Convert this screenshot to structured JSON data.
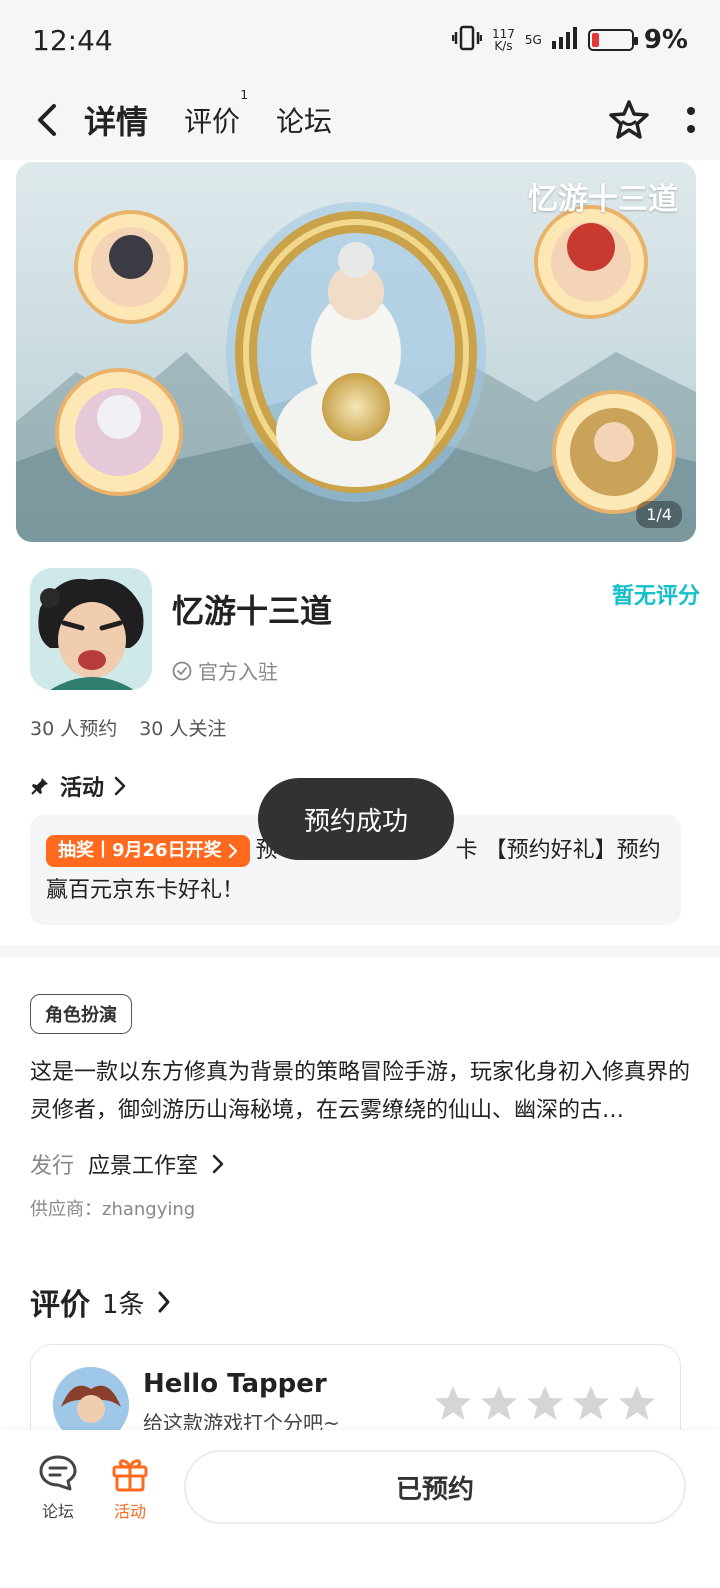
{
  "status_bar": {
    "time": "12:44",
    "net_speed_value": "117",
    "net_speed_unit": "K/s",
    "network": "5G",
    "battery_percent": "9%",
    "battery_level": 0.09
  },
  "nav": {
    "tabs": [
      {
        "label": "详情",
        "active": true
      },
      {
        "label": "评价",
        "badge": "1"
      },
      {
        "label": "论坛"
      }
    ]
  },
  "banner": {
    "title": "忆游十三道",
    "page_indicator": "1/4"
  },
  "app": {
    "title": "忆游十三道",
    "official_label": "官方入驻",
    "rating_label": "暂无评分",
    "reserve_count": "30 人预约",
    "follow_count": "30 人关注"
  },
  "activity": {
    "heading": "活动",
    "tag_label": "抽奖丨9月26日开奖",
    "text_prefix": "预",
    "text_mid": "卡 【预约好礼】预约",
    "text_line2": "赢百元京东卡好礼！"
  },
  "toast": {
    "text": "预约成功"
  },
  "genre_tag": "角色扮演",
  "description": "这是一款以东方修真为背景的策略冒险手游，玩家化身初入修真界的灵修者，御剑游历山海秘境，在云雾缭绕的仙山、幽深的古…",
  "publisher": {
    "label": "发行",
    "value": "应景工作室"
  },
  "supplier": "供应商：zhangying",
  "reviews": {
    "title": "评价",
    "count": "1条",
    "reviewer_name": "Hello Tapper",
    "prompt": "给这款游戏打个分吧~",
    "stars_total": 5
  },
  "bottom_bar": {
    "forum_label": "论坛",
    "activity_label": "活动",
    "reserve_button": "已预约"
  },
  "colors": {
    "accent": "#14c0c9",
    "orange": "#ff6a1e",
    "toast_bg": "#323232"
  }
}
